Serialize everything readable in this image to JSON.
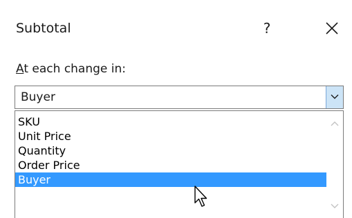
{
  "dialog": {
    "title": "Subtotal",
    "help_label": "?",
    "close_icon": "close-icon"
  },
  "field": {
    "label_accel": "A",
    "label_rest": "t each change in:",
    "selected_value": "Buyer"
  },
  "dropdown": {
    "options": [
      "SKU",
      "Unit Price",
      "Quantity",
      "Order Price",
      "Buyer"
    ],
    "highlighted": "Buyer"
  },
  "colors": {
    "highlight": "#3399ff",
    "combo_button": "#cce4f7"
  }
}
